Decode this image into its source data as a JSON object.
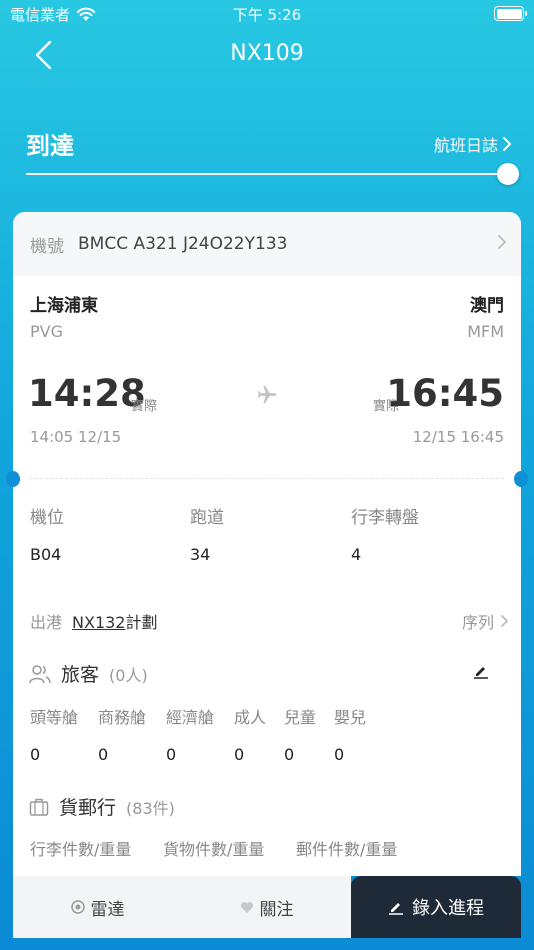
{
  "status_bar": {
    "carrier": "電信業者",
    "time": "下午 5:26"
  },
  "nav": {
    "title": "NX109"
  },
  "flight_status": {
    "label": "到達",
    "log_link": "航班日誌",
    "progress": 1.0
  },
  "aircraft": {
    "label": "機號",
    "value": "BMCC A321 J24O22Y133"
  },
  "origin": {
    "city": "上海浦東",
    "code": "PVG",
    "actual_time": "14:28",
    "actual_tag": "實際",
    "scheduled": "14:05 12/15"
  },
  "destination": {
    "city": "澳門",
    "code": "MFM",
    "actual_time": "16:45",
    "actual_tag": "實際",
    "scheduled": "12/15 16:45"
  },
  "gate_info": {
    "stand_label": "機位",
    "stand_value": "B04",
    "runway_label": "跑道",
    "runway_value": "34",
    "carousel_label": "行李轉盤",
    "carousel_value": "4"
  },
  "departure": {
    "label": "出港",
    "flight": "NX132",
    "plan": "計劃",
    "sequence": "序列"
  },
  "passengers": {
    "title": "旅客",
    "count": "(0人)",
    "columns": [
      {
        "label": "頭等艙",
        "value": "0"
      },
      {
        "label": "商務艙",
        "value": "0"
      },
      {
        "label": "經濟艙",
        "value": "0"
      },
      {
        "label": "成人",
        "value": "0"
      },
      {
        "label": "兒童",
        "value": "0"
      },
      {
        "label": "嬰兒",
        "value": "0"
      }
    ]
  },
  "cargo": {
    "title": "貨郵行",
    "count": "(83件)",
    "columns": [
      "行李件數/重量",
      "貨物件數/重量",
      "郵件件數/重量"
    ]
  },
  "bottom_bar": {
    "radar": "雷達",
    "follow": "關注",
    "record": "錄入進程"
  },
  "colors": {
    "accent_dark": "#1F2A38",
    "gradient_top": "#28C8E2",
    "gradient_bottom": "#0B8BD4"
  }
}
